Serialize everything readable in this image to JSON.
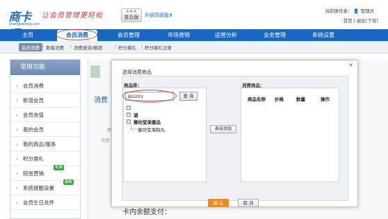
{
  "header": {
    "logo_text": "商卡通",
    "logo_url_text": "shangkatong.com",
    "slogan": "让会员管理更轻松",
    "edition_stars": "★★★",
    "edition_label": "普及版",
    "upgrade_link": "升级高级版",
    "operator_label": "当前操作者：",
    "operator_name": "管理员",
    "home_link": "首页",
    "logout_link": "退出(下班)"
  },
  "nav": {
    "items": [
      "主页",
      "会员消费",
      "会员管理",
      "市场营销",
      "运营分析",
      "业务管理",
      "系统设置"
    ],
    "active_index": 1
  },
  "subnav": {
    "items": [
      "会员消费",
      "散客消费",
      "消费查询/撤销",
      "积分换礼",
      "积分换礼记录"
    ],
    "active_index": 0,
    "separator": "|"
  },
  "sidebar": {
    "title": "常用功能",
    "items": [
      {
        "label": "会员消费"
      },
      {
        "label": "新增会员"
      },
      {
        "label": "会员充值"
      },
      {
        "label": "我的会员"
      },
      {
        "label": "我的商品/服务"
      },
      {
        "label": "积分换礼"
      },
      {
        "label": "短信营销",
        "badge": "免费"
      },
      {
        "label": "系统提醒设置",
        "badge": "最新"
      },
      {
        "label": "会员生日关怀"
      }
    ]
  },
  "main": {
    "tab_label": "消费",
    "faded_text_1": "滴",
    "faded_text_2": "历史",
    "bottom_text": "卡内余额支付："
  },
  "dialog": {
    "title": "选择消费商品",
    "close": "×",
    "library_label": "商品库：",
    "search_value": "BG003",
    "query_button": "查 询",
    "tree": {
      "root_toggle": "－",
      "node1_toggle": "－",
      "node1_label": "酒",
      "node2_toggle": "－",
      "node2_label": "御坊堂保健品",
      "leaf_label": "御坊堂海狗丸"
    },
    "add_button": "表击添加",
    "selected_label": "消费商品：",
    "columns": [
      "商品名称",
      "价格",
      "数量",
      "操作"
    ],
    "ok_button": "确 认",
    "cancel_button": "取 消"
  },
  "colors": {
    "nav_blue": "#1768c2",
    "highlight_red": "#e03030",
    "confirm_orange": "#f08a1c",
    "badge_green": "#3aa73a"
  }
}
